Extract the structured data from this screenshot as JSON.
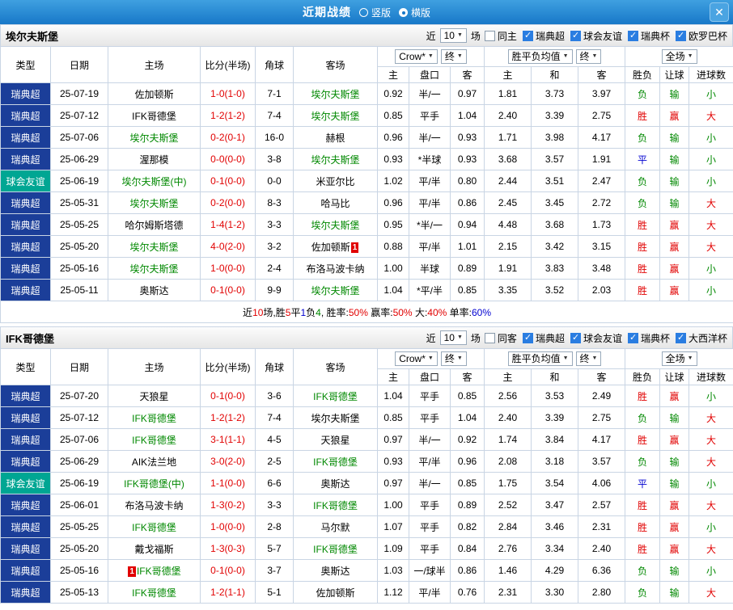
{
  "header": {
    "title": "近期战绩",
    "radios": [
      {
        "label": "竖版",
        "selected": false
      },
      {
        "label": "横版",
        "selected": true
      }
    ],
    "close_label": "✕"
  },
  "table_head": {
    "col_type": "类型",
    "col_date": "日期",
    "col_home": "主场",
    "col_score": "比分(半场)",
    "col_corner": "角球",
    "col_away": "客场",
    "asia_select1": "Crow*",
    "asia_select2": "终",
    "europe_select1": "胜平负均值",
    "europe_select2": "终",
    "full_select": "全场",
    "sub_asia_home": "主",
    "sub_asia_handicap": "盘口",
    "sub_asia_away": "客",
    "sub_euro_home": "主",
    "sub_euro_draw": "和",
    "sub_euro_away": "客",
    "sub_result": "胜负",
    "sub_handicap_result": "让球",
    "sub_goals": "进球数"
  },
  "sections": [
    {
      "team": "埃尔夫斯堡",
      "filter": {
        "near": "近",
        "count": "10",
        "games": "场",
        "same": {
          "label": "同主",
          "checked": false
        },
        "leagues": [
          {
            "label": "瑞典超",
            "checked": true
          },
          {
            "label": "球会友谊",
            "checked": true
          },
          {
            "label": "瑞典杯",
            "checked": true
          },
          {
            "label": "欧罗巴杯",
            "checked": true
          }
        ]
      },
      "rows": [
        {
          "type": "瑞典超",
          "type_style": "league",
          "date": "25-07-19",
          "home": "佐加顿斯",
          "home_focus": false,
          "score": "1-0(1-0)",
          "corner": "7-1",
          "away": "埃尔夫斯堡",
          "away_focus": true,
          "o1": "0.92",
          "hc": "半/一",
          "o2": "0.97",
          "e1": "1.81",
          "e2": "3.73",
          "e3": "3.97",
          "r1": "负",
          "r1c": "g",
          "r2": "输",
          "r2c": "g",
          "r3": "小",
          "r3c": "g"
        },
        {
          "type": "瑞典超",
          "type_style": "league",
          "date": "25-07-12",
          "home": "IFK哥德堡",
          "home_focus": false,
          "score": "1-2(1-2)",
          "corner": "7-4",
          "away": "埃尔夫斯堡",
          "away_focus": true,
          "o1": "0.85",
          "hc": "平手",
          "o2": "1.04",
          "e1": "2.40",
          "e2": "3.39",
          "e3": "2.75",
          "r1": "胜",
          "r1c": "r",
          "r2": "赢",
          "r2c": "r",
          "r3": "大",
          "r3c": "r"
        },
        {
          "type": "瑞典超",
          "type_style": "league",
          "date": "25-07-06",
          "home": "埃尔夫斯堡",
          "home_focus": true,
          "score": "0-2(0-1)",
          "corner": "16-0",
          "away": "赫根",
          "away_focus": false,
          "o1": "0.96",
          "hc": "半/一",
          "o2": "0.93",
          "e1": "1.71",
          "e2": "3.98",
          "e3": "4.17",
          "r1": "负",
          "r1c": "g",
          "r2": "输",
          "r2c": "g",
          "r3": "小",
          "r3c": "g"
        },
        {
          "type": "瑞典超",
          "type_style": "league",
          "date": "25-06-29",
          "home": "渥那模",
          "home_focus": false,
          "score": "0-0(0-0)",
          "corner": "3-8",
          "away": "埃尔夫斯堡",
          "away_focus": true,
          "o1": "0.93",
          "hc": "*半球",
          "o2": "0.93",
          "e1": "3.68",
          "e2": "3.57",
          "e3": "1.91",
          "r1": "平",
          "r1c": "b",
          "r2": "输",
          "r2c": "g",
          "r3": "小",
          "r3c": "g"
        },
        {
          "type": "球会友谊",
          "type_style": "friendly",
          "date": "25-06-19",
          "home": "埃尔夫斯堡(中)",
          "home_focus": true,
          "score": "0-1(0-0)",
          "corner": "0-0",
          "away": "米亚尔比",
          "away_focus": false,
          "o1": "1.02",
          "hc": "平/半",
          "o2": "0.80",
          "e1": "2.44",
          "e2": "3.51",
          "e3": "2.47",
          "r1": "负",
          "r1c": "g",
          "r2": "输",
          "r2c": "g",
          "r3": "小",
          "r3c": "g"
        },
        {
          "type": "瑞典超",
          "type_style": "league",
          "date": "25-05-31",
          "home": "埃尔夫斯堡",
          "home_focus": true,
          "score": "0-2(0-0)",
          "corner": "8-3",
          "away": "哈马比",
          "away_focus": false,
          "o1": "0.96",
          "hc": "平/半",
          "o2": "0.86",
          "e1": "2.45",
          "e2": "3.45",
          "e3": "2.72",
          "r1": "负",
          "r1c": "g",
          "r2": "输",
          "r2c": "g",
          "r3": "大",
          "r3c": "r"
        },
        {
          "type": "瑞典超",
          "type_style": "league",
          "date": "25-05-25",
          "home": "哈尔姆斯塔德",
          "home_focus": false,
          "score": "1-4(1-2)",
          "corner": "3-3",
          "away": "埃尔夫斯堡",
          "away_focus": true,
          "o1": "0.95",
          "hc": "*半/一",
          "o2": "0.94",
          "e1": "4.48",
          "e2": "3.68",
          "e3": "1.73",
          "r1": "胜",
          "r1c": "r",
          "r2": "赢",
          "r2c": "r",
          "r3": "大",
          "r3c": "r"
        },
        {
          "type": "瑞典超",
          "type_style": "league",
          "date": "25-05-20",
          "home": "埃尔夫斯堡",
          "home_focus": true,
          "score": "4-0(2-0)",
          "corner": "3-2",
          "away": "佐加顿斯",
          "away_focus": false,
          "away_card": "1",
          "away_card_pos": "after",
          "o1": "0.88",
          "hc": "平/半",
          "o2": "1.01",
          "e1": "2.15",
          "e2": "3.42",
          "e3": "3.15",
          "r1": "胜",
          "r1c": "r",
          "r2": "赢",
          "r2c": "r",
          "r3": "大",
          "r3c": "r"
        },
        {
          "type": "瑞典超",
          "type_style": "league",
          "date": "25-05-16",
          "home": "埃尔夫斯堡",
          "home_focus": true,
          "score": "1-0(0-0)",
          "corner": "2-4",
          "away": "布洛马波卡纳",
          "away_focus": false,
          "o1": "1.00",
          "hc": "半球",
          "o2": "0.89",
          "e1": "1.91",
          "e2": "3.83",
          "e3": "3.48",
          "r1": "胜",
          "r1c": "r",
          "r2": "赢",
          "r2c": "r",
          "r3": "小",
          "r3c": "g"
        },
        {
          "type": "瑞典超",
          "type_style": "league",
          "date": "25-05-11",
          "home": "奥斯达",
          "home_focus": false,
          "score": "0-1(0-0)",
          "corner": "9-9",
          "away": "埃尔夫斯堡",
          "away_focus": true,
          "o1": "1.04",
          "hc": "*平/半",
          "o2": "0.85",
          "e1": "3.35",
          "e2": "3.52",
          "e3": "2.03",
          "r1": "胜",
          "r1c": "r",
          "r2": "赢",
          "r2c": "r",
          "r3": "小",
          "r3c": "g"
        }
      ],
      "summary": [
        {
          "t": "近",
          "c": "k"
        },
        {
          "t": "10",
          "c": "r"
        },
        {
          "t": "场,胜",
          "c": "k"
        },
        {
          "t": "5",
          "c": "r"
        },
        {
          "t": "平",
          "c": "k"
        },
        {
          "t": "1",
          "c": "b"
        },
        {
          "t": "负",
          "c": "k"
        },
        {
          "t": "4",
          "c": "g"
        },
        {
          "t": ", 胜率:",
          "c": "k"
        },
        {
          "t": "50%",
          "c": "r"
        },
        {
          "t": " 赢率:",
          "c": "k"
        },
        {
          "t": "50%",
          "c": "r"
        },
        {
          "t": " 大:",
          "c": "k"
        },
        {
          "t": "40%",
          "c": "r"
        },
        {
          "t": " 单率:",
          "c": "k"
        },
        {
          "t": "60%",
          "c": "b"
        }
      ]
    },
    {
      "team": "IFK哥德堡",
      "filter": {
        "near": "近",
        "count": "10",
        "games": "场",
        "same": {
          "label": "同客",
          "checked": false
        },
        "leagues": [
          {
            "label": "瑞典超",
            "checked": true
          },
          {
            "label": "球会友谊",
            "checked": true
          },
          {
            "label": "瑞典杯",
            "checked": true
          },
          {
            "label": "大西洋杯",
            "checked": true
          }
        ]
      },
      "rows": [
        {
          "type": "瑞典超",
          "type_style": "league",
          "date": "25-07-20",
          "home": "天狼星",
          "home_focus": false,
          "score": "0-1(0-0)",
          "corner": "3-6",
          "away": "IFK哥德堡",
          "away_focus": true,
          "o1": "1.04",
          "hc": "平手",
          "o2": "0.85",
          "e1": "2.56",
          "e2": "3.53",
          "e3": "2.49",
          "r1": "胜",
          "r1c": "r",
          "r2": "赢",
          "r2c": "r",
          "r3": "小",
          "r3c": "g"
        },
        {
          "type": "瑞典超",
          "type_style": "league",
          "date": "25-07-12",
          "home": "IFK哥德堡",
          "home_focus": true,
          "score": "1-2(1-2)",
          "corner": "7-4",
          "away": "埃尔夫斯堡",
          "away_focus": false,
          "o1": "0.85",
          "hc": "平手",
          "o2": "1.04",
          "e1": "2.40",
          "e2": "3.39",
          "e3": "2.75",
          "r1": "负",
          "r1c": "g",
          "r2": "输",
          "r2c": "g",
          "r3": "大",
          "r3c": "r"
        },
        {
          "type": "瑞典超",
          "type_style": "league",
          "date": "25-07-06",
          "home": "IFK哥德堡",
          "home_focus": true,
          "score": "3-1(1-1)",
          "corner": "4-5",
          "away": "天狼星",
          "away_focus": false,
          "o1": "0.97",
          "hc": "半/一",
          "o2": "0.92",
          "e1": "1.74",
          "e2": "3.84",
          "e3": "4.17",
          "r1": "胜",
          "r1c": "r",
          "r2": "赢",
          "r2c": "r",
          "r3": "大",
          "r3c": "r"
        },
        {
          "type": "瑞典超",
          "type_style": "league",
          "date": "25-06-29",
          "home": "AIK法兰地",
          "home_focus": false,
          "score": "3-0(2-0)",
          "corner": "2-5",
          "away": "IFK哥德堡",
          "away_focus": true,
          "o1": "0.93",
          "hc": "平/半",
          "o2": "0.96",
          "e1": "2.08",
          "e2": "3.18",
          "e3": "3.57",
          "r1": "负",
          "r1c": "g",
          "r2": "输",
          "r2c": "g",
          "r3": "大",
          "r3c": "r"
        },
        {
          "type": "球会友谊",
          "type_style": "friendly",
          "date": "25-06-19",
          "home": "IFK哥德堡(中)",
          "home_focus": true,
          "score": "1-1(0-0)",
          "corner": "6-6",
          "away": "奥斯达",
          "away_focus": false,
          "o1": "0.97",
          "hc": "半/一",
          "o2": "0.85",
          "e1": "1.75",
          "e2": "3.54",
          "e3": "4.06",
          "r1": "平",
          "r1c": "b",
          "r2": "输",
          "r2c": "g",
          "r3": "小",
          "r3c": "g"
        },
        {
          "type": "瑞典超",
          "type_style": "league",
          "date": "25-06-01",
          "home": "布洛马波卡纳",
          "home_focus": false,
          "score": "1-3(0-2)",
          "corner": "3-3",
          "away": "IFK哥德堡",
          "away_focus": true,
          "o1": "1.00",
          "hc": "平手",
          "o2": "0.89",
          "e1": "2.52",
          "e2": "3.47",
          "e3": "2.57",
          "r1": "胜",
          "r1c": "r",
          "r2": "赢",
          "r2c": "r",
          "r3": "大",
          "r3c": "r"
        },
        {
          "type": "瑞典超",
          "type_style": "league",
          "date": "25-05-25",
          "home": "IFK哥德堡",
          "home_focus": true,
          "score": "1-0(0-0)",
          "corner": "2-8",
          "away": "马尔默",
          "away_focus": false,
          "o1": "1.07",
          "hc": "平手",
          "o2": "0.82",
          "e1": "2.84",
          "e2": "3.46",
          "e3": "2.31",
          "r1": "胜",
          "r1c": "r",
          "r2": "赢",
          "r2c": "r",
          "r3": "小",
          "r3c": "g"
        },
        {
          "type": "瑞典超",
          "type_style": "league",
          "date": "25-05-20",
          "home": "戴戈福斯",
          "home_focus": false,
          "score": "1-3(0-3)",
          "corner": "5-7",
          "away": "IFK哥德堡",
          "away_focus": true,
          "o1": "1.09",
          "hc": "平手",
          "o2": "0.84",
          "e1": "2.76",
          "e2": "3.34",
          "e3": "2.40",
          "r1": "胜",
          "r1c": "r",
          "r2": "赢",
          "r2c": "r",
          "r3": "大",
          "r3c": "r"
        },
        {
          "type": "瑞典超",
          "type_style": "league",
          "date": "25-05-16",
          "home": "IFK哥德堡",
          "home_focus": true,
          "home_card": "1",
          "home_card_pos": "before",
          "score": "0-1(0-0)",
          "corner": "3-7",
          "away": "奥斯达",
          "away_focus": false,
          "o1": "1.03",
          "hc": "一/球半",
          "o2": "0.86",
          "e1": "1.46",
          "e2": "4.29",
          "e3": "6.36",
          "r1": "负",
          "r1c": "g",
          "r2": "输",
          "r2c": "g",
          "r3": "小",
          "r3c": "g"
        },
        {
          "type": "瑞典超",
          "type_style": "league",
          "date": "25-05-13",
          "home": "IFK哥德堡",
          "home_focus": true,
          "score": "1-2(1-1)",
          "corner": "5-1",
          "away": "佐加顿斯",
          "away_focus": false,
          "o1": "1.12",
          "hc": "平/半",
          "o2": "0.76",
          "e1": "2.31",
          "e2": "3.30",
          "e3": "2.80",
          "r1": "负",
          "r1c": "g",
          "r2": "输",
          "r2c": "g",
          "r3": "大",
          "r3c": "r"
        }
      ]
    }
  ]
}
